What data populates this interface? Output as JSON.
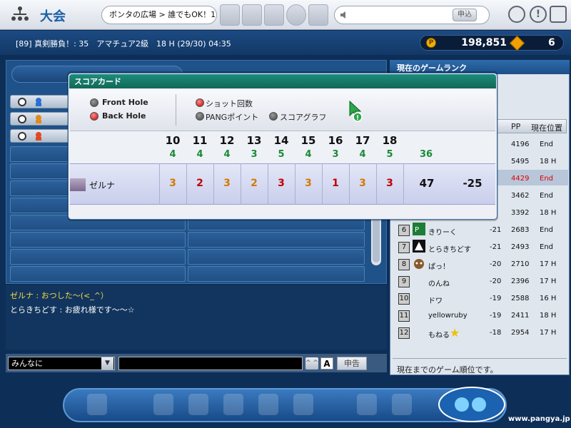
{
  "header": {
    "title": "大会",
    "lobby_path": "ボンタの広場 > 誰でもOK！1",
    "apply_label": "申込",
    "help_label": "!"
  },
  "status": {
    "room_info": "[89] 真剣勝負！: 35　アマチュア2級　18 H (29/30) 04:35",
    "pang": "198,851",
    "gems": "6"
  },
  "chat": {
    "lines": [
      "ゼルナ : おつした～(<_^）",
      "とらきちどす : お疲れ様です～～☆"
    ],
    "target": "みんなに",
    "font_label": "A",
    "caret_label": "^ ^",
    "report_label": "申告"
  },
  "ranking": {
    "title": "現在のゲームランク",
    "col_pp": "PP",
    "col_pos": "現在位置",
    "rows": [
      {
        "pp": "4196",
        "pos": "End"
      },
      {
        "pp": "5495",
        "pos": "18 H"
      },
      {
        "pp": "4429",
        "pos": "End"
      },
      {
        "pp": "3462",
        "pos": "End"
      },
      {
        "pp": "3392",
        "pos": "18 H"
      },
      {
        "rank": "6",
        "name": "きりーく",
        "score": "-21",
        "pp": "2683",
        "pos": "End"
      },
      {
        "rank": "7",
        "name": "とらきちどす",
        "score": "-21",
        "pp": "2493",
        "pos": "End"
      },
      {
        "rank": "8",
        "name": "ぱっ！",
        "score": "-20",
        "pp": "2710",
        "pos": "17 H"
      },
      {
        "rank": "9",
        "name": "のんね",
        "score": "-20",
        "pp": "2396",
        "pos": "17 H"
      },
      {
        "rank": "10",
        "name": "ドワ",
        "score": "-19",
        "pp": "2588",
        "pos": "16 H"
      },
      {
        "rank": "11",
        "name": "yellowruby",
        "score": "-19",
        "pp": "2411",
        "pos": "18 H"
      },
      {
        "rank": "12",
        "name": "もねる",
        "score": "-18",
        "pp": "2954",
        "pos": "17 H"
      }
    ],
    "footer": "現在までのゲーム順位です。"
  },
  "scorecard": {
    "title": "スコアカード",
    "options": {
      "front_hole": "Front Hole",
      "back_hole": "Back Hole",
      "shot_count": "ショット回数",
      "pang_points": "PANGポイント",
      "score_graph": "スコアグラフ"
    },
    "holes": [
      "10",
      "11",
      "12",
      "13",
      "14",
      "15",
      "16",
      "17",
      "18"
    ],
    "pars": [
      "4",
      "4",
      "4",
      "3",
      "5",
      "4",
      "3",
      "4",
      "5"
    ],
    "par_total": "36",
    "player": "ゼルナ",
    "scores": [
      "3",
      "2",
      "3",
      "2",
      "3",
      "3",
      "1",
      "3",
      "3"
    ],
    "total": "47",
    "diff": "-25"
  },
  "footer": {
    "site": "www.pangya.jp"
  },
  "colors": {
    "accent_blue": "#1b5fa6",
    "scorecard_green": "#1a8a37",
    "birdie_red": "#c00000",
    "par_orange": "#d27a00",
    "highlight_red": "#e00000"
  }
}
